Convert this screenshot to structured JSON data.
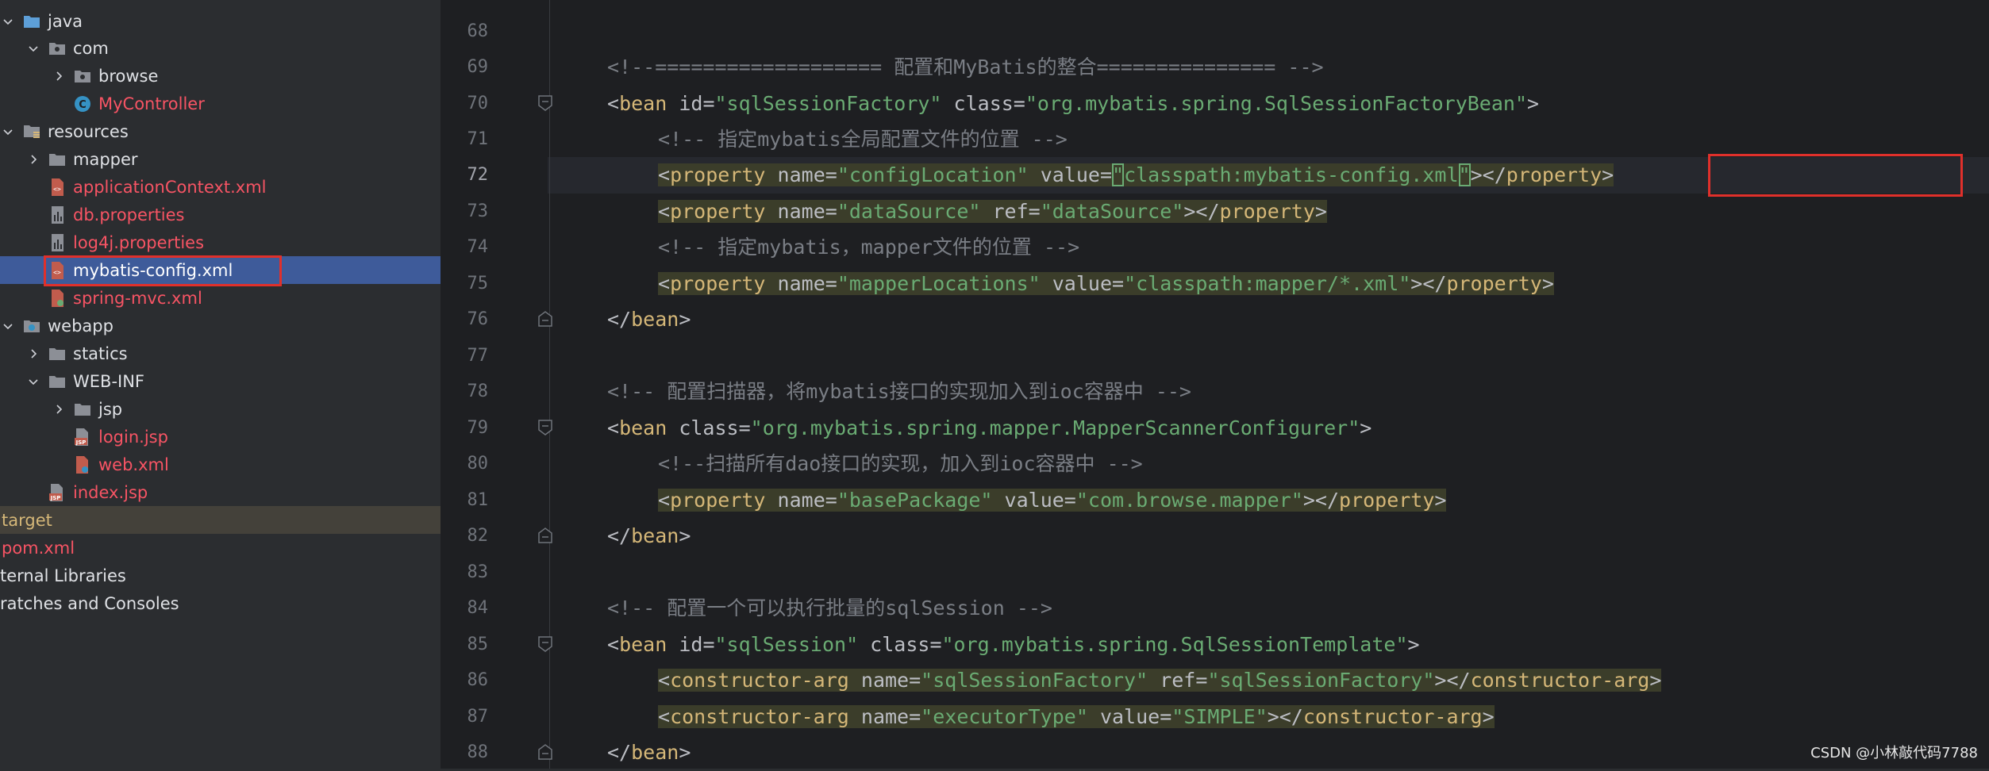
{
  "tree": {
    "items": [
      {
        "label": "java",
        "indent": 0,
        "arrow": "down",
        "icon": "folder-icon",
        "color": "normal"
      },
      {
        "label": "com",
        "indent": 1,
        "arrow": "down",
        "icon": "package-icon",
        "color": "normal"
      },
      {
        "label": "browse",
        "indent": 2,
        "arrow": "right",
        "icon": "package-icon",
        "color": "normal"
      },
      {
        "label": "MyController",
        "indent": 2,
        "arrow": "none",
        "icon": "class-icon",
        "color": "red"
      },
      {
        "label": "resources",
        "indent": 0,
        "arrow": "down",
        "icon": "resources-folder-icon",
        "color": "normal"
      },
      {
        "label": "mapper",
        "indent": 1,
        "arrow": "right",
        "icon": "folder-icon",
        "color": "normal"
      },
      {
        "label": "applicationContext.xml",
        "indent": 1,
        "arrow": "none",
        "icon": "xml-file-icon",
        "color": "red"
      },
      {
        "label": "db.properties",
        "indent": 1,
        "arrow": "none",
        "icon": "properties-file-icon",
        "color": "red"
      },
      {
        "label": "log4j.properties",
        "indent": 1,
        "arrow": "none",
        "icon": "properties-file-icon",
        "color": "red"
      },
      {
        "label": "mybatis-config.xml",
        "indent": 1,
        "arrow": "none",
        "icon": "xml-file-icon",
        "color": "selected"
      },
      {
        "label": "spring-mvc.xml",
        "indent": 1,
        "arrow": "none",
        "icon": "xml-file-icon",
        "color": "red"
      },
      {
        "label": "webapp",
        "indent": 0,
        "arrow": "down",
        "icon": "web-folder-icon",
        "color": "normal"
      },
      {
        "label": "statics",
        "indent": 1,
        "arrow": "right",
        "icon": "folder-icon",
        "color": "normal"
      },
      {
        "label": "WEB-INF",
        "indent": 1,
        "arrow": "down",
        "icon": "folder-icon",
        "color": "normal"
      },
      {
        "label": "jsp",
        "indent": 2,
        "arrow": "right",
        "icon": "folder-icon",
        "color": "normal"
      },
      {
        "label": "login.jsp",
        "indent": 2,
        "arrow": "none",
        "icon": "jsp-file-icon",
        "color": "red"
      },
      {
        "label": "web.xml",
        "indent": 2,
        "arrow": "none",
        "icon": "web-xml-file-icon",
        "color": "red"
      },
      {
        "label": "index.jsp",
        "indent": 1,
        "arrow": "none",
        "icon": "jsp-file-icon",
        "color": "red"
      },
      {
        "label": "target",
        "indent": -1,
        "arrow": "none",
        "icon": "none",
        "color": "target"
      },
      {
        "label": "pom.xml",
        "indent": -1,
        "arrow": "none",
        "icon": "none",
        "color": "red"
      },
      {
        "label": "ternal Libraries",
        "indent": -1,
        "arrow": "none",
        "icon": "none",
        "color": "normal"
      },
      {
        "label": "ratches and Consoles",
        "indent": -1,
        "arrow": "none",
        "icon": "none",
        "color": "normal"
      }
    ]
  },
  "editor": {
    "line_numbers": [
      "68",
      "69",
      "70",
      "71",
      "72",
      "73",
      "74",
      "75",
      "76",
      "77",
      "78",
      "79",
      "80",
      "81",
      "82",
      "83",
      "84",
      "85",
      "86",
      "87",
      "88"
    ],
    "current_line": "72",
    "lines": {
      "l69": {
        "c": "<!--=================== 配置和MyBatis的整合=============== -->"
      },
      "l70": {
        "open": "<",
        "tag": "bean",
        "a1": " id",
        "eq1": "=",
        "v1": "\"sqlSessionFactory\"",
        "a2": " class",
        "eq2": "=",
        "v2": "\"org.mybatis.spring.SqlSessionFactoryBean\"",
        "close": ">"
      },
      "l71": {
        "c": "<!-- 指定mybatis全局配置文件的位置 -->"
      },
      "l72": {
        "open": "<",
        "tag": "property",
        "a1": " name",
        "eq1": "=",
        "v1": "\"configLocation\"",
        "a2": " value",
        "eq2": "=",
        "q": "\"",
        "v2a": "classpath:",
        "v2b": "mybatis-config.xml",
        "q2": "\"",
        "close": "></",
        "tag2": "property",
        "end": ">"
      },
      "l73": {
        "open": "<",
        "tag": "property",
        "a1": " name",
        "eq1": "=",
        "v1": "\"dataSource\"",
        "a2": " ref",
        "eq2": "=",
        "v2": "\"dataSource\"",
        "close": "></",
        "tag2": "property",
        "end": ">"
      },
      "l74": {
        "c": "<!-- 指定mybatis，mapper文件的位置 -->"
      },
      "l75": {
        "open": "<",
        "tag": "property",
        "a1": " name",
        "eq1": "=",
        "v1": "\"mapperLocations\"",
        "a2": " value",
        "eq2": "=",
        "v2": "\"classpath:mapper/*.xml\"",
        "close": "></",
        "tag2": "property",
        "end": ">"
      },
      "l76": {
        "open": "</",
        "tag": "bean",
        "close": ">"
      },
      "l78": {
        "c": "<!-- 配置扫描器，将mybatis接口的实现加入到ioc容器中 -->"
      },
      "l79": {
        "open": "<",
        "tag": "bean",
        "a1": " class",
        "eq1": "=",
        "v1": "\"org.mybatis.spring.mapper.MapperScannerConfigurer\"",
        "close": ">"
      },
      "l80": {
        "c": "<!--扫描所有dao接口的实现，加入到ioc容器中 -->"
      },
      "l81": {
        "open": "<",
        "tag": "property",
        "a1": " name",
        "eq1": "=",
        "v1": "\"basePackage\"",
        "a2": " value",
        "eq2": "=",
        "v2": "\"com.browse.mapper\"",
        "close": "></",
        "tag2": "property",
        "end": ">"
      },
      "l82": {
        "open": "</",
        "tag": "bean",
        "close": ">"
      },
      "l84": {
        "c": "<!-- 配置一个可以执行批量的sqlSession -->"
      },
      "l85": {
        "open": "<",
        "tag": "bean",
        "a1": " id",
        "eq1": "=",
        "v1": "\"sqlSession\"",
        "a2": " class",
        "eq2": "=",
        "v2": "\"org.mybatis.spring.SqlSessionTemplate\"",
        "close": ">"
      },
      "l86": {
        "open": "<",
        "tag": "constructor-arg",
        "a1": " name",
        "eq1": "=",
        "v1": "\"sqlSessionFactory\"",
        "a2": " ref",
        "eq2": "=",
        "v2": "\"sqlSessionFactory\"",
        "close": "></",
        "tag2": "constructor-arg",
        "end": ">"
      },
      "l87": {
        "open": "<",
        "tag": "constructor-arg",
        "a1": " name",
        "eq1": "=",
        "v1": "\"executorType\"",
        "a2": " value",
        "eq2": "=",
        "v2": "\"SIMPLE\"",
        "close": "></",
        "tag2": "constructor-arg",
        "end": ">"
      },
      "l88": {
        "open": "</",
        "tag": "bean",
        "close": ">"
      }
    }
  },
  "watermark": "CSDN @小林敲代码7788",
  "colors": {
    "sidebar_bg": "#2b2d30",
    "editor_bg": "#1e1f22",
    "selection": "#3e5b9a",
    "tag": "#d5b778",
    "string": "#6aab73",
    "comment": "#7a7e85",
    "highlight_box": "#e0302b"
  }
}
